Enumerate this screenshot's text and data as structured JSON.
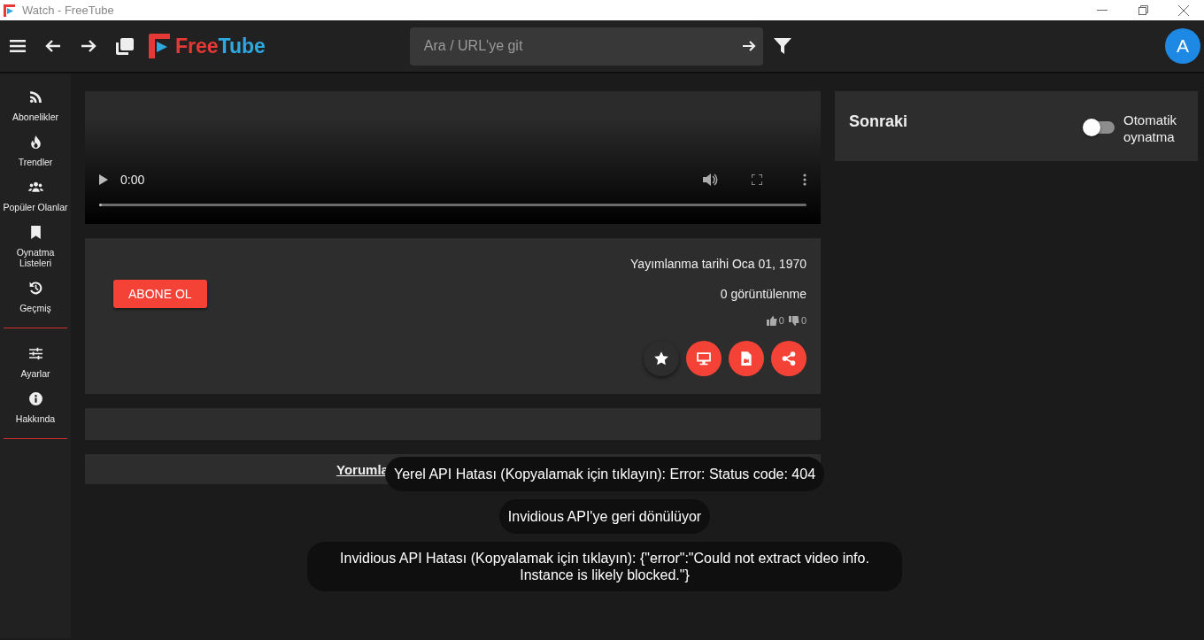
{
  "window": {
    "title": "Watch - FreeTube"
  },
  "top_bar": {
    "logo": {
      "first": "Free",
      "second": "Tube"
    },
    "search": {
      "placeholder": "Ara / URL'ye git"
    },
    "avatar": "A"
  },
  "sidebar": {
    "groups": [
      [
        {
          "kind": "rss",
          "label": "Abonelikler"
        },
        {
          "kind": "fire",
          "label": "Trendler"
        },
        {
          "kind": "users",
          "label": "Popüler Olanlar"
        },
        {
          "kind": "bookmark",
          "label": "Oynatma Listeleri"
        },
        {
          "kind": "history",
          "label": "Geçmiş"
        }
      ],
      [
        {
          "kind": "sliders",
          "label": "Ayarlar"
        },
        {
          "kind": "info",
          "label": "Hakkında"
        }
      ]
    ]
  },
  "video": {
    "time": "0:00",
    "level": 0
  },
  "info": {
    "subscribe": "ABONE OL",
    "published": "Yayımlanma tarihi Oca 01, 1970",
    "views": "0 görüntülenme",
    "likes": "0",
    "dislikes": "0",
    "actions": [
      {
        "kind": "star"
      },
      {
        "kind": "monitor"
      },
      {
        "kind": "file-video"
      },
      {
        "kind": "share"
      }
    ]
  },
  "comments": {
    "link": "Yorumla"
  },
  "up_next": {
    "title": "Sonraki",
    "autoplay_label": "Otomatik oynatma",
    "autoplay": false
  },
  "toasts": [
    "Yerel API Hatası (Kopyalamak için tıklayın): Error: Status code: 404",
    "Invidious API'ye geri dönülüyor",
    "Invidious API Hatası (Kopyalamak için tıklayın): {\"error\":\"Could not extract video info. Instance is likely blocked.\"}"
  ]
}
